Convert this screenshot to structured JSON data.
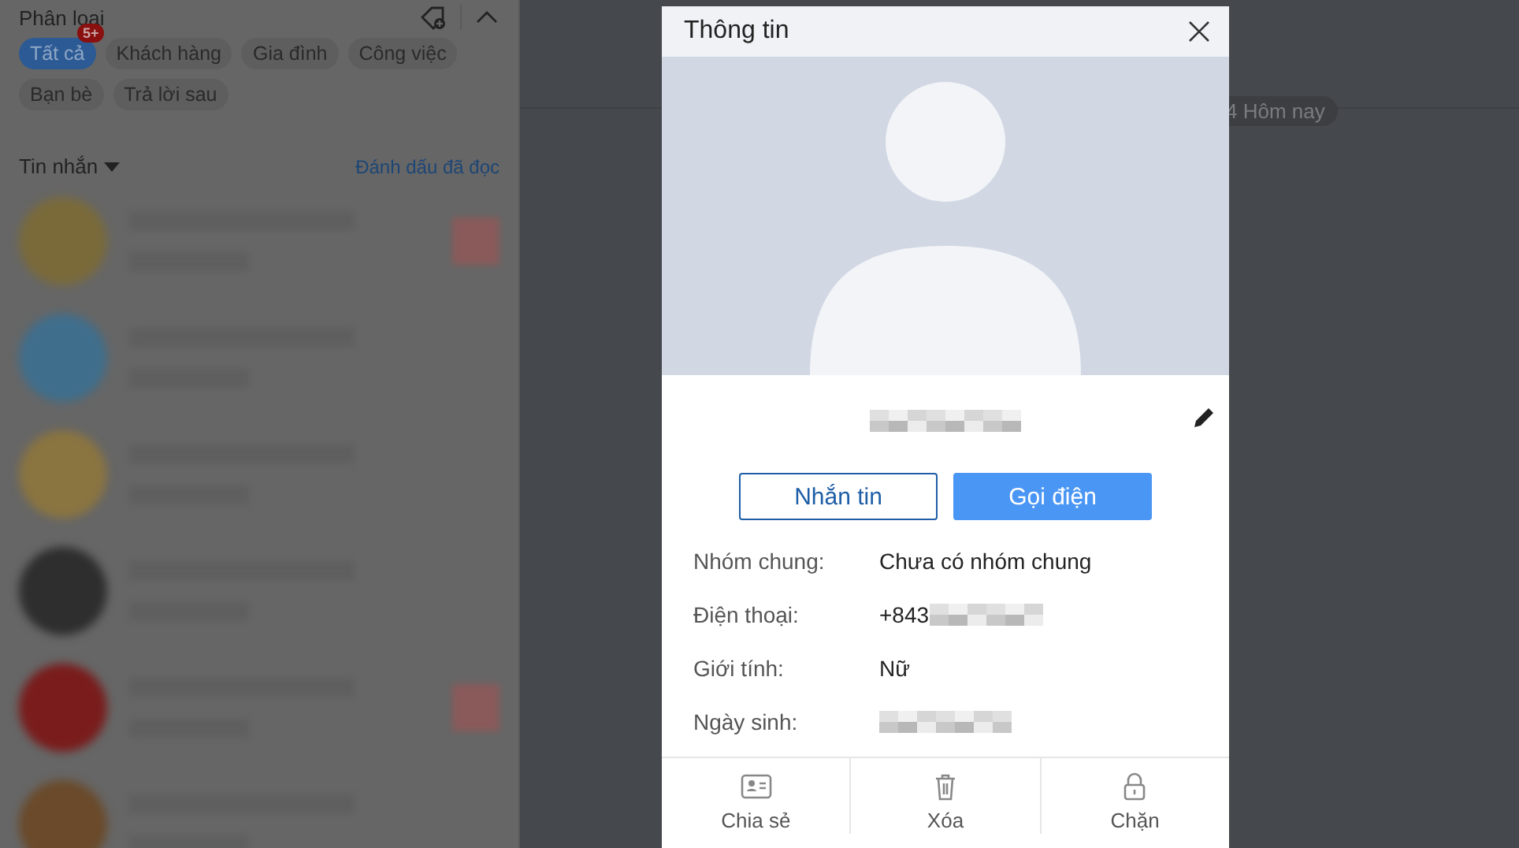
{
  "sidebar": {
    "title": "Phân loại",
    "filters": [
      {
        "label": "Tất cả",
        "selected": true,
        "badge": "5+"
      },
      {
        "label": "Khách hàng",
        "selected": false
      },
      {
        "label": "Gia đình",
        "selected": false
      },
      {
        "label": "Công việc",
        "selected": false
      },
      {
        "label": "Bạn bè",
        "selected": false
      },
      {
        "label": "Trả lời sau",
        "selected": false
      }
    ],
    "messages_header": "Tin nhắn",
    "mark_read_link": "Đánh dấu đã đọc",
    "conversations": [
      {
        "color": "#7a6a3a",
        "unread": true
      },
      {
        "color": "#3f6e8c",
        "unread": false
      },
      {
        "color": "#8a7440",
        "unread": false
      },
      {
        "color": "#2e2e2e",
        "unread": false
      },
      {
        "color": "#7a1c1c",
        "unread": true
      },
      {
        "color": "#6a4a2a",
        "unread": false
      }
    ]
  },
  "chat": {
    "date_label": "4 Hôm nay"
  },
  "dialog": {
    "title": "Thông tin",
    "buttons": [
      {
        "label": "Nhắn tin",
        "kind": "outline"
      },
      {
        "label": "Gọi điện",
        "kind": "primary"
      }
    ],
    "fields": [
      {
        "label": "Nhóm chung:",
        "value": "Chưa có nhóm chung"
      },
      {
        "label": "Điện thoại:",
        "value": "+843",
        "redacted": true
      },
      {
        "label": "Giới tính:",
        "value": "Nữ"
      },
      {
        "label": "Ngày sinh:",
        "redacted": true
      }
    ],
    "actions": [
      {
        "label": "Chia sẻ",
        "kind": "share"
      },
      {
        "label": "Xóa",
        "kind": "delete"
      },
      {
        "label": "Chặn",
        "kind": "block"
      }
    ]
  }
}
